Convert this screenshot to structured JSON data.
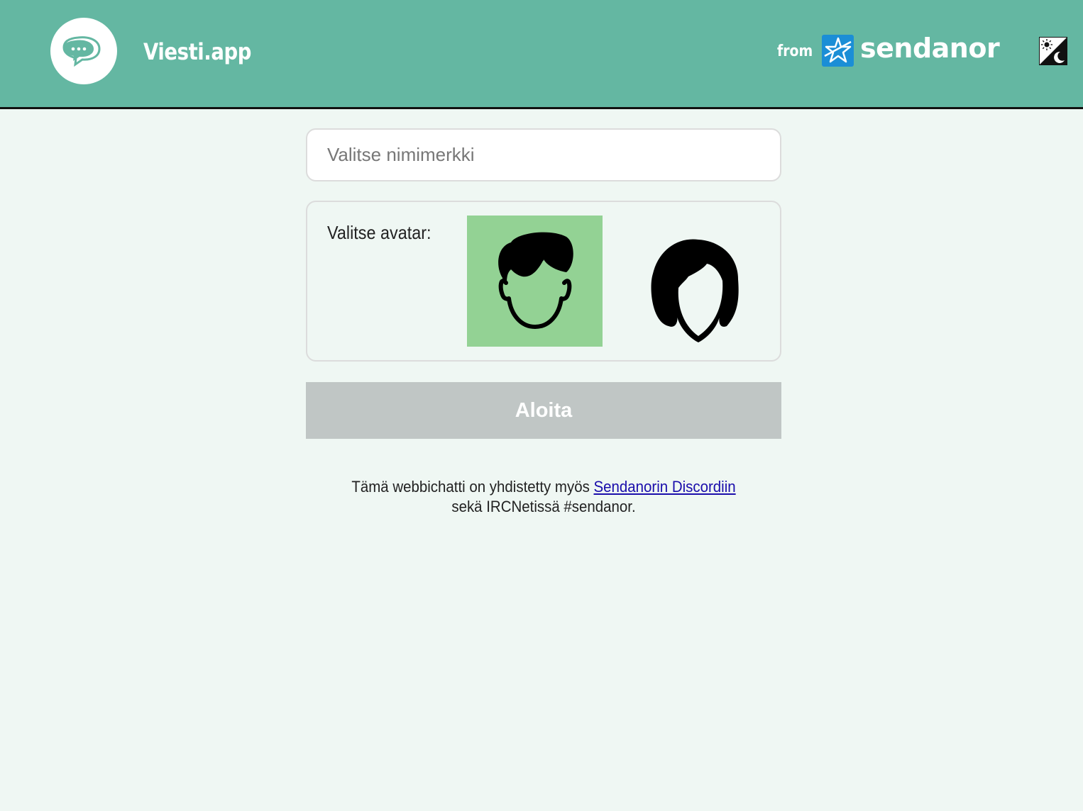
{
  "header": {
    "app_title": "Viesti.app",
    "from_label": "from",
    "brand_name": "sendanor",
    "logo_icon": "chat-bubbles-icon",
    "brand_icon": "sendanor-star-icon",
    "theme_icon": "sun-moon-toggle-icon",
    "colors": {
      "header_bg": "#64b7a2",
      "brand_icon_bg": "#1b8ed6"
    }
  },
  "form": {
    "nickname": {
      "placeholder": "Valitse nimimerkki",
      "value": ""
    },
    "avatar_label": "Valitse avatar:",
    "avatars": [
      {
        "name": "male",
        "selected": true,
        "icon": "male-avatar-icon"
      },
      {
        "name": "female",
        "selected": false,
        "icon": "female-avatar-icon"
      }
    ],
    "selected_color": "#93d294",
    "start_button": "Aloita",
    "start_button_color": "#c0c6c5"
  },
  "info": {
    "text_before": "Tämä webbichatti on yhdistetty myös ",
    "link_text": "Sendanorin Discordiin",
    "line2": "sekä IRCNetissä #sendanor."
  }
}
